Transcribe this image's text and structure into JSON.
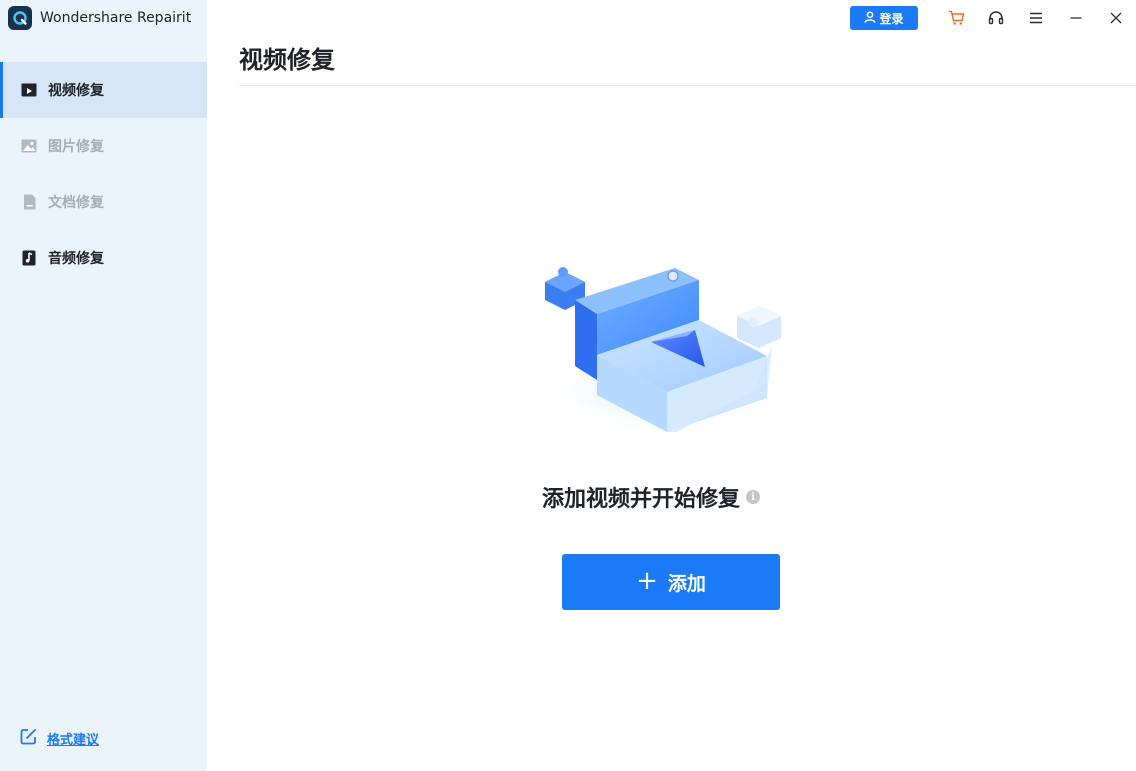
{
  "app": {
    "title": "Wondershare Repairit"
  },
  "sidebar": {
    "items": [
      {
        "label": "视频修复",
        "icon": "video-icon",
        "active": true
      },
      {
        "label": "图片修复",
        "icon": "image-icon",
        "active": false
      },
      {
        "label": "文档修复",
        "icon": "document-icon",
        "active": false
      },
      {
        "label": "音频修复",
        "icon": "music-icon",
        "active": false
      }
    ],
    "feedback_label": "格式建议"
  },
  "titlebar": {
    "login_label": "登录",
    "icons": [
      "cart-icon",
      "headset-icon",
      "menu-icon",
      "minimize-icon",
      "close-icon"
    ]
  },
  "main": {
    "title": "视频修复",
    "prompt": "添加视频并开始修复",
    "add_plus": "+",
    "add_label": "添加"
  },
  "colors": {
    "accent": "#1a7af8",
    "sidebar_bg": "#ebf3fb",
    "sidebar_active_bg": "#d6e6f6",
    "cart": "#f26a1b"
  }
}
